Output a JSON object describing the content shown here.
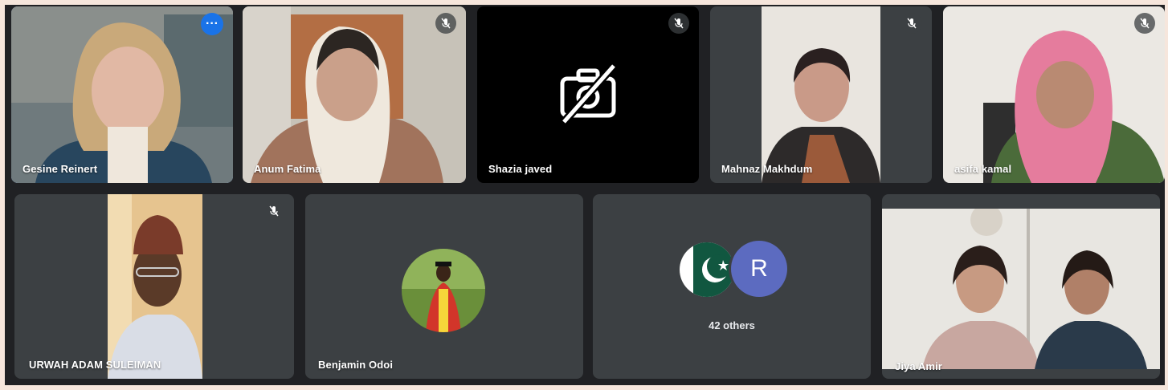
{
  "meeting": {
    "participants": [
      {
        "name": "Gesine Reinert",
        "muted": false,
        "active_speaker": true
      },
      {
        "name": "Anum Fatima",
        "muted": true
      },
      {
        "name": "Shazia javed",
        "muted": true,
        "camera_off": true
      },
      {
        "name": "Mahnaz Makhdum",
        "muted": true
      },
      {
        "name": "asifa kamal",
        "muted": true
      },
      {
        "name": "URWAH ADAM SULEIMAN",
        "muted": true
      },
      {
        "name": "Benjamin Odoi",
        "muted": false
      },
      {
        "name": "Jiya Amir",
        "muted": false
      }
    ],
    "others": {
      "label": "42 others",
      "avatar_letter": "R",
      "avatar_color": "#5c6bc0"
    }
  },
  "icons": {
    "mute": "mic-off-icon",
    "more": "more-options-icon",
    "camera_off": "camera-off-icon"
  },
  "colors": {
    "active_border": "#8ab4f8",
    "more_button": "#1a73e8",
    "tile": "#3c4043",
    "stage": "#202124"
  }
}
